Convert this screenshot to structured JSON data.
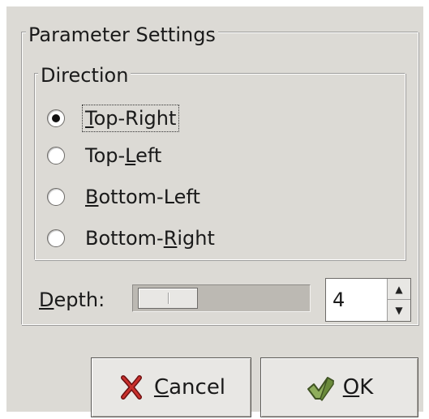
{
  "dialog": {
    "group_title": "Parameter Settings",
    "direction": {
      "title": "Direction",
      "options": [
        {
          "pre": "",
          "mn": "T",
          "post": "op-Right",
          "checked": true
        },
        {
          "pre": "Top-",
          "mn": "L",
          "post": "eft",
          "checked": false
        },
        {
          "pre": "",
          "mn": "B",
          "post": "ottom-Left",
          "checked": false
        },
        {
          "pre": "Bottom-",
          "mn": "R",
          "post": "ight",
          "checked": false
        }
      ]
    },
    "depth": {
      "label_mn": "D",
      "label_rest": "epth:",
      "value": "4",
      "slider_fraction": 0.05
    },
    "buttons": {
      "cancel": {
        "mn": "C",
        "rest": "ancel",
        "icon": "x-cancel-icon"
      },
      "ok": {
        "mn": "O",
        "rest": "K",
        "icon": "check-ok-icon"
      }
    }
  }
}
